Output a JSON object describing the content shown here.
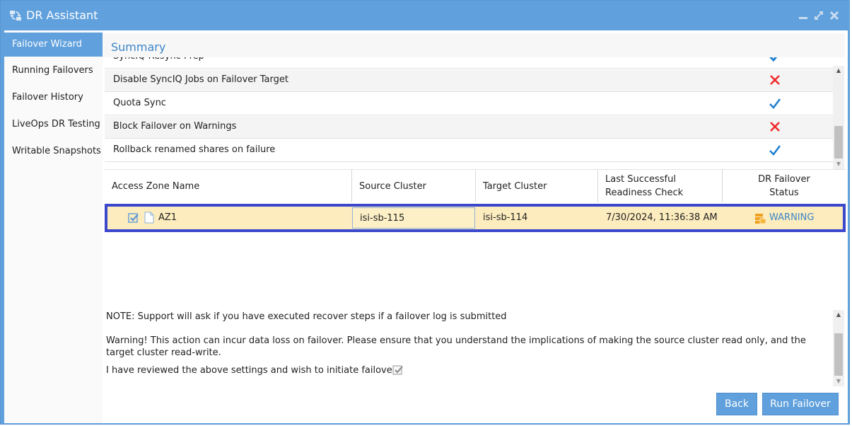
{
  "window": {
    "title": "DR Assistant",
    "app_icon": "failover-swap-icon",
    "controls": {
      "minimize": "minimize-icon",
      "maximize": "maximize-icon",
      "close": "close-icon"
    }
  },
  "sidebar": {
    "items": [
      {
        "label": "Failover Wizard",
        "active": true
      },
      {
        "label": "Running Failovers",
        "active": false
      },
      {
        "label": "Failover History",
        "active": false
      },
      {
        "label": "LiveOps DR Testing",
        "active": false
      },
      {
        "label": "Writable Snapshots",
        "active": false
      }
    ]
  },
  "main": {
    "section_title": "Summary",
    "settings": [
      {
        "label": "SyncIQ Resync Prep",
        "value": "check"
      },
      {
        "label": "Disable SyncIQ Jobs on Failover Target",
        "value": "cross"
      },
      {
        "label": "Quota Sync",
        "value": "check"
      },
      {
        "label": "Block Failover on Warnings",
        "value": "cross"
      },
      {
        "label": "Rollback renamed shares on failure",
        "value": "check"
      }
    ],
    "grid": {
      "columns": [
        "Access Zone Name",
        "Source Cluster",
        "Target Cluster",
        "Last Successful Readiness Check",
        "DR Failover Status"
      ],
      "rows": [
        {
          "checked": true,
          "access_zone": "AZ1",
          "source_cluster": "isi-sb-115",
          "target_cluster": "isi-sb-114",
          "last_check": "7/30/2024, 11:36:38 AM",
          "status": "WARNING"
        }
      ]
    },
    "note": "NOTE: Support will ask if you have executed recover steps if a failover log is submitted",
    "warning": "Warning! This action can incur data loss on failover. Please ensure that you understand the implications of making the source cluster read only, and the target cluster read-write.",
    "confirm_label": "I have reviewed the above settings and wish to initiate failover:",
    "confirm_checked": true,
    "buttons": {
      "back": "Back",
      "run": "Run Failover"
    }
  },
  "colors": {
    "accent": "#5fa0dd",
    "check": "#1f7fd0",
    "cross": "#f02a2a",
    "warning_icon": "#f0a020",
    "warning_text": "#3c86c8",
    "row_highlight": "#fcecbe",
    "row_outline": "#3b48cc"
  }
}
